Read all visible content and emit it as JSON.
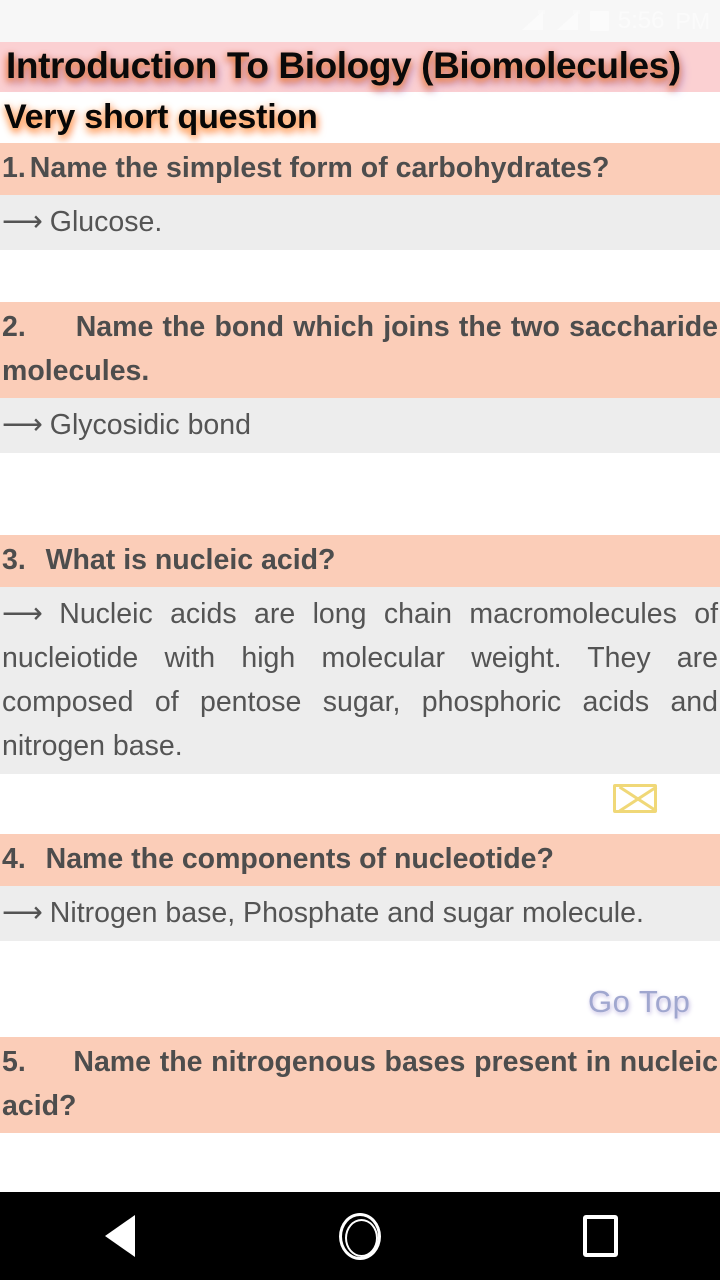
{
  "status_bar": {
    "signal_icon_1": "signal-bars-icon",
    "signal_icon_2": "signal-bars-icon",
    "battery_icon": "battery-icon",
    "time": "5:56",
    "ampm": "PM"
  },
  "header": {
    "page_title": "Introduction To Biology (Biomolecules)",
    "section_title": "Very short question",
    "title_band_color": "#fbd0d2",
    "title_glow_color": "#ff8c28"
  },
  "theme": {
    "question_bg": "#fbcdb8",
    "question_text": "#4d4d4d",
    "answer_bg": "#ededed",
    "answer_text": "#545454",
    "page_bg": "#ffffff",
    "go_top_color": "#a0a7cf",
    "envelope_color": "#f0d878",
    "nav_bar_bg": "#000000"
  },
  "float_controls": {
    "go_top_label": "Go Top",
    "share_icon": "envelope-icon"
  },
  "qa_list": [
    {
      "number": "1.",
      "question": "Name the simplest form of carbohydrates?",
      "justified": false,
      "arrow": "⟶",
      "answer": "Glucose.",
      "answer_justified": false
    },
    {
      "number": "2.",
      "question": "Name the bond which joins the two saccharide molecules.",
      "justified": true,
      "arrow": "⟶",
      "answer": "Glycosidic bond",
      "answer_justified": false
    },
    {
      "number": "3.",
      "question": "What is nucleic acid?",
      "justified": false,
      "arrow": "⟶",
      "answer": "Nucleic acids are long chain macromolecules of nucleiotide with high molecular weight. They are composed of pentose sugar, phosphoric acids and nitrogen base.",
      "answer_justified": true
    },
    {
      "number": "4.",
      "question": "Name the components of nucleotide?",
      "justified": false,
      "arrow": "⟶",
      "answer": "Nitrogen base, Phosphate and sugar molecule.",
      "answer_justified": false
    },
    {
      "number": "5.",
      "question": "Name the nitrogenous bases present in nucleic acid?",
      "justified": true,
      "arrow": "⟶",
      "answer": "",
      "answer_justified": false
    }
  ],
  "nav_bar": {
    "back_icon": "back-triangle-icon",
    "home_icon": "home-circle-icon",
    "recents_icon": "recents-square-icon"
  }
}
